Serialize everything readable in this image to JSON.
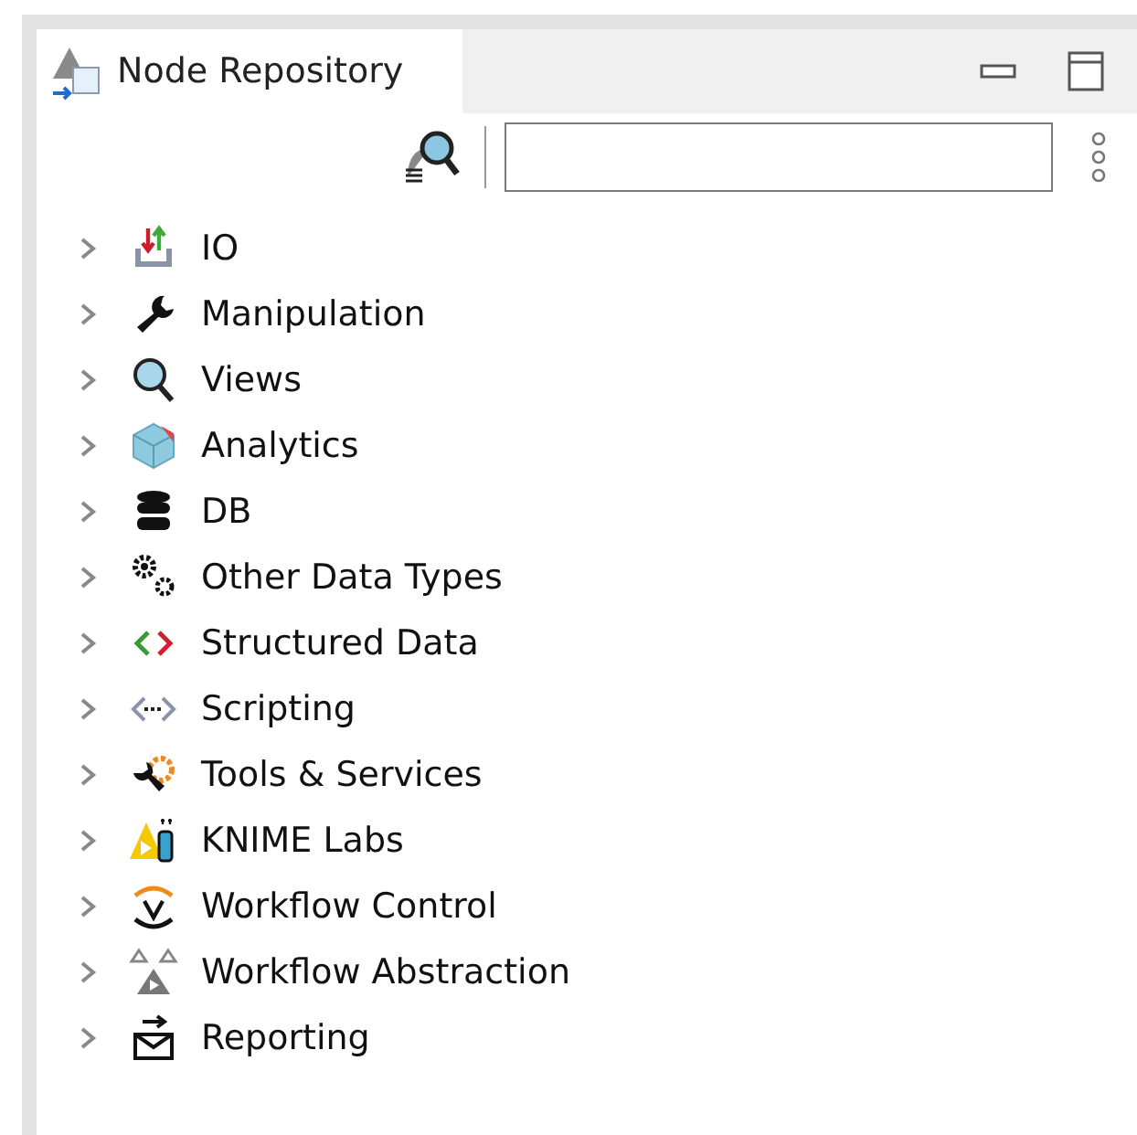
{
  "view": {
    "title": "Node Repository",
    "selected": true
  },
  "tree": [
    {
      "label": "IO",
      "expanded": false
    },
    {
      "label": "Manipulation",
      "expanded": false
    },
    {
      "label": "Views",
      "expanded": false
    },
    {
      "label": "Analytics",
      "expanded": false
    },
    {
      "label": "DB",
      "expanded": false
    },
    {
      "label": "Other Data Types",
      "expanded": false
    },
    {
      "label": "Structured Data",
      "expanded": false
    },
    {
      "label": "Scripting",
      "expanded": false
    },
    {
      "label": "Tools & Services",
      "expanded": false
    },
    {
      "label": "KNIME Labs",
      "expanded": false
    },
    {
      "label": "Workflow Control",
      "expanded": false
    },
    {
      "label": "Workflow Abstraction",
      "expanded": false
    },
    {
      "label": "Reporting",
      "expanded": false
    }
  ]
}
